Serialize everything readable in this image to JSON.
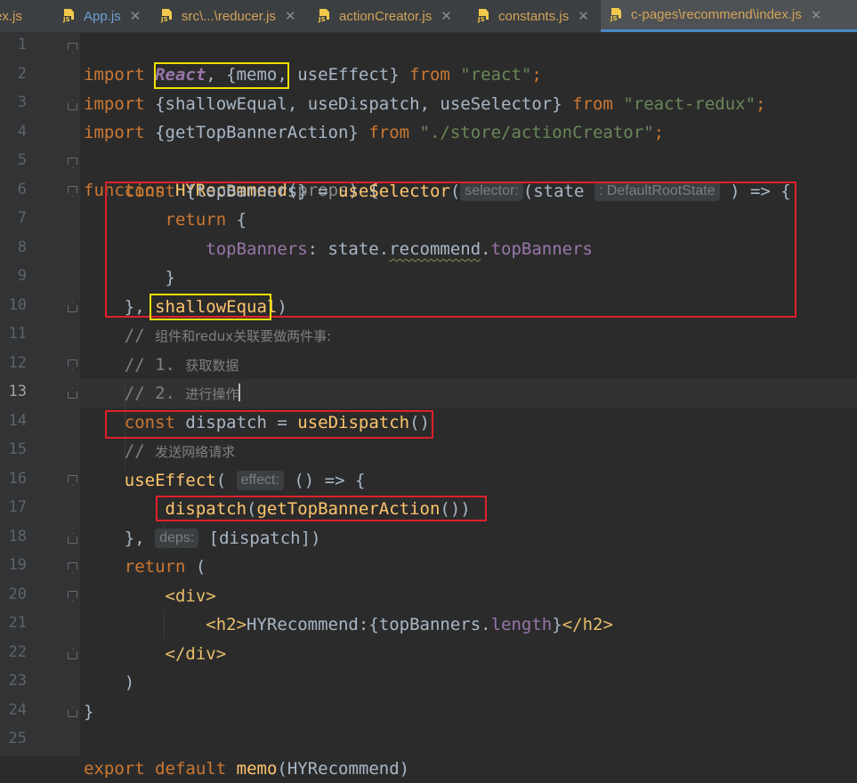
{
  "tabs": [
    {
      "label": "ex.js",
      "color": "orange",
      "active": false
    },
    {
      "label": "App.js",
      "color": "blue",
      "active": false
    },
    {
      "label": "src\\...\\reducer.js",
      "color": "orange",
      "active": false
    },
    {
      "label": "actionCreator.js",
      "color": "orange",
      "active": false
    },
    {
      "label": "constants.js",
      "color": "orange",
      "active": false
    },
    {
      "label": "c-pages\\recommend\\index.js",
      "color": "orange",
      "active": true
    }
  ],
  "editor": {
    "current_line": 13,
    "line_numbers": [
      "1",
      "2",
      "3",
      "4",
      "5",
      "6",
      "7",
      "8",
      "9",
      "10",
      "11",
      "12",
      "13",
      "14",
      "15",
      "16",
      "17",
      "18",
      "19",
      "20",
      "21",
      "22",
      "23",
      "24",
      "25"
    ],
    "code": {
      "import_kw": "import",
      "from_kw": "from",
      "l1_react": "React",
      "l1_rest": ", {memo, useEffect} ",
      "l1_str": "\"react\"",
      "l1_semi": ";",
      "l2_open": " {",
      "l2_shallow": "shallowEqual",
      "l2_rest": ", useDispatch, useSelector} ",
      "l2_str": "\"react-redux\"",
      "l3_rest": " {getTopBannerAction} ",
      "l3_str": "\"./store/actionCreator\"",
      "function_kw": "function",
      "l5_name": "HYRecommend",
      "l5_param": "props",
      "l5_open": "(",
      "l5_close": ") {",
      "const_kw": "const",
      "l6_destruct": " {topBanners} = ",
      "l6_fn": "useSelector",
      "l6_hint": "selector:",
      "l6_state": "(state",
      "l6_type_hint": ": DefaultRootState",
      "l6_arrow": ") => {",
      "return_kw": "return",
      "l7_brace": " {",
      "l8_prop": "topBanners",
      "l8_mid": ": state.",
      "l8_recommend": "recommend",
      "l8_dot": ".",
      "l8_prop2": "topBanners",
      "l9": "}",
      "l10_start": "}, ",
      "l10_shallow": "shallowEqual",
      "l10_end": ")",
      "l11_slash": "// ",
      "l11_text": "组件和redux关联要做两件事:",
      "l12_slash": "// 1. ",
      "l12_text": "获取数据",
      "l13_slash": "// 2. ",
      "l13_text": "进行操作",
      "l14_mid": " dispatch = ",
      "l14_fn": "useDispatch",
      "l14_end": "()",
      "l15_slash": "// ",
      "l15_text": "发送网络请求",
      "l16_fn": "useEffect",
      "l16_open": "(",
      "l16_hint": "effect:",
      "l16_rest": " () => {",
      "l17_fn1": "dispatch",
      "l17_open": "(",
      "l17_fn2": "getTopBannerAction",
      "l17_end": "())",
      "l18_start": "}, ",
      "l18_hint": "deps:",
      "l18_rest": " [dispatch])",
      "l19_rest": " (",
      "l20_tag": "<div>",
      "l21_open": "<h2>",
      "l21_text": "HYRecommend:{topBanners.",
      "l21_prop": "length",
      "l21_close_brace": "}",
      "l21_close": "</h2>",
      "l22_tag": "</div>",
      "l23": ")",
      "l24": "}",
      "export_kw": "export",
      "default_kw": "default",
      "l25_fn": "memo",
      "l25_rest": "(HYRecommend)"
    }
  },
  "annotation_colors": {
    "red": "#e0202a",
    "yellow": "#f0e000"
  }
}
